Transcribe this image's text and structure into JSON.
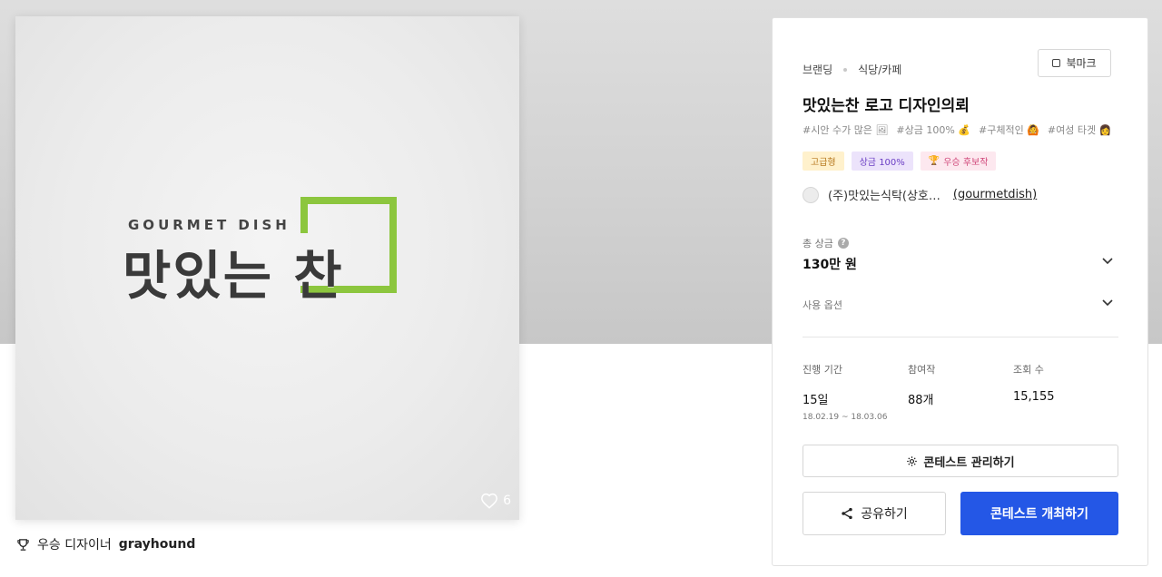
{
  "artwork": {
    "logo_subtitle": "GOURMET DISH",
    "logo_title": "맛있는 찬",
    "like_count": "6",
    "accent_color": "#8cc63e"
  },
  "winner": {
    "prefix": "우승 디자이너",
    "name": "grayhound"
  },
  "contest": {
    "category": "브랜딩",
    "subcategory": "식당/카페",
    "bookmark_label": "북마크",
    "title": "맛있는찬 로고 디자인의뢰",
    "tags": [
      "#시안 수가 많은 🖼",
      "#상금 100% 💰",
      "#구체적인 🙆",
      "#여성 타겟 👩"
    ],
    "badges": [
      "고급형",
      "상금 100%",
      "우승 후보작"
    ],
    "host_name": "(주)맛있는식탁(상호…",
    "host_handle": "(gourmetdish)",
    "prize_label": "총 상금",
    "prize_help": "?",
    "prize_value": "130만 원",
    "options_label": "사용 옵션",
    "stats": {
      "period_label": "진행 기간",
      "period_value": "15일",
      "period_dates": "18.02.19 ~ 18.03.06",
      "entries_label": "참여작",
      "entries_value": "88개",
      "views_label": "조회 수",
      "views_value": "15,155"
    },
    "manage_label": "콘테스트 관리하기",
    "share_label": "공유하기",
    "host_contest_label": "콘테스트 개최하기",
    "primary_color": "#2457e6"
  }
}
